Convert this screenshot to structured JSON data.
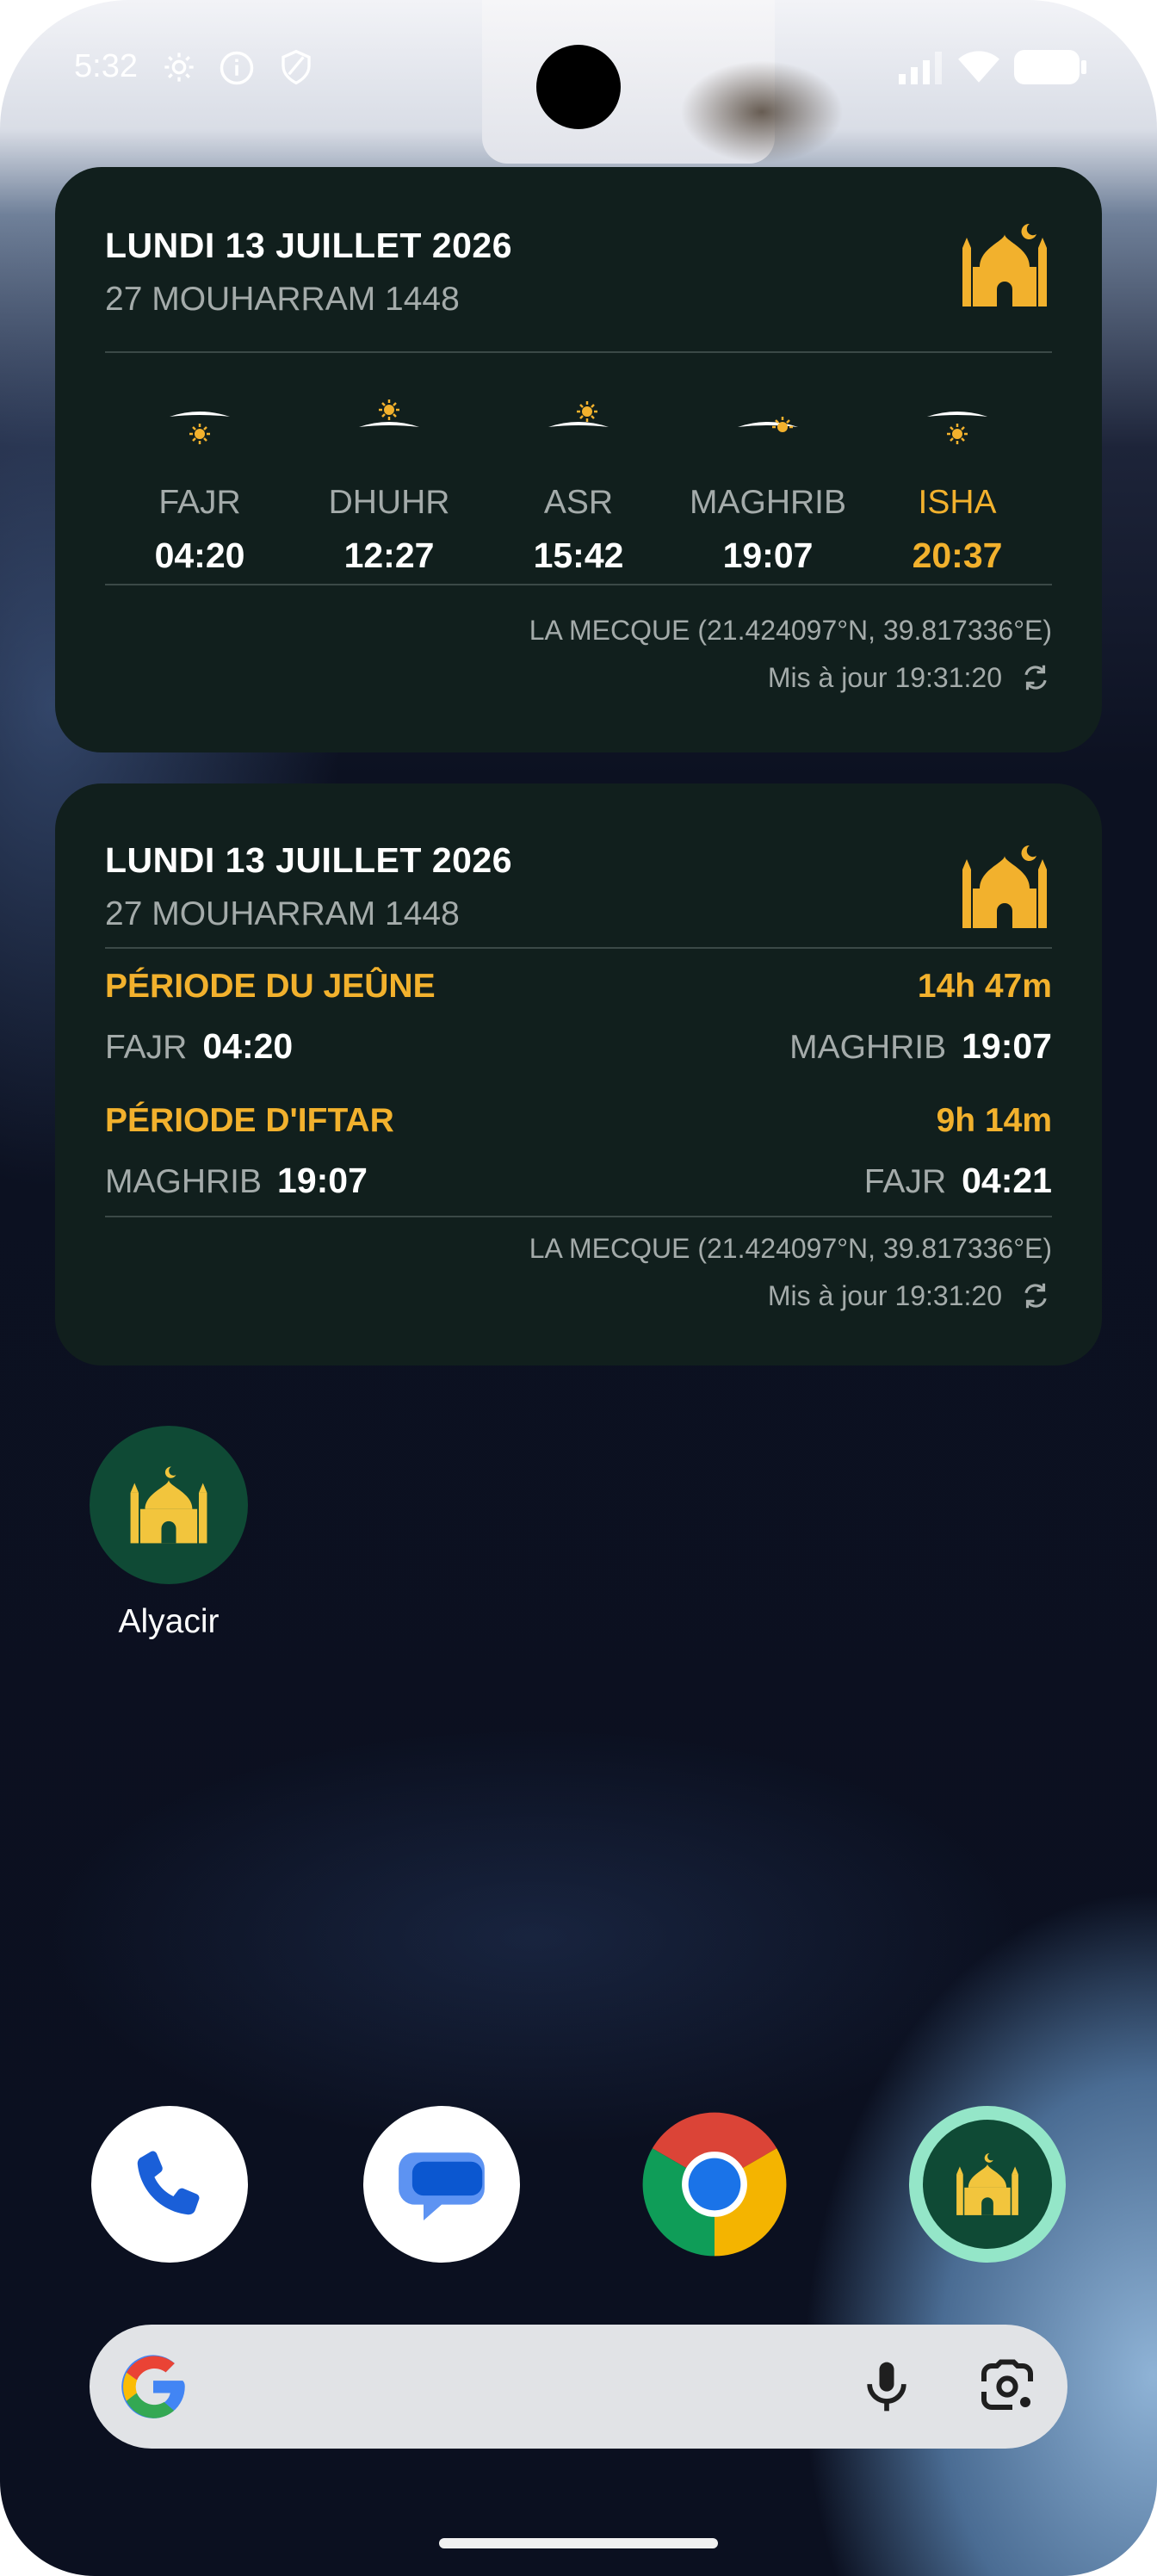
{
  "status_bar": {
    "time": "5:32",
    "icons_left": [
      "gear-icon",
      "info-icon",
      "shield-icon"
    ],
    "icons_right": [
      "signal-icon",
      "wifi-icon",
      "battery-icon"
    ]
  },
  "colors": {
    "widget_bg": "#111f1d",
    "accent": "#f2b12d",
    "muted": "#a4abaa",
    "app_icon_bg": "#0f4a35",
    "app_icon_ring": "#94e6c8"
  },
  "prayer_widget": {
    "date": "LUNDI 13 JUILLET 2026",
    "hijri": "27 MOUHARRAM 1448",
    "prayers": [
      {
        "name": "FAJR",
        "time": "04:20",
        "active": false
      },
      {
        "name": "DHUHR",
        "time": "12:27",
        "active": false
      },
      {
        "name": "ASR",
        "time": "15:42",
        "active": false
      },
      {
        "name": "MAGHRIB",
        "time": "19:07",
        "active": false
      },
      {
        "name": "ISHA",
        "time": "20:37",
        "active": true
      }
    ],
    "location": "LA MECQUE (21.424097°N, 39.817336°E)",
    "updated": "Mis à jour 19:31:20"
  },
  "fasting_widget": {
    "date": "LUNDI 13 JUILLET 2026",
    "hijri": "27 MOUHARRAM 1448",
    "fasting": {
      "label": "PÉRIODE DU JEÛNE",
      "duration": "14h 47m",
      "start_name": "FAJR",
      "start_time": "04:20",
      "end_name": "MAGHRIB",
      "end_time": "19:07"
    },
    "iftar": {
      "label": "PÉRIODE D'IFTAR",
      "duration": "9h 14m",
      "start_name": "MAGHRIB",
      "start_time": "19:07",
      "end_name": "FAJR",
      "end_time": "04:21"
    },
    "location": "LA MECQUE (21.424097°N, 39.817336°E)",
    "updated": "Mis à jour 19:31:20"
  },
  "home": {
    "app_label": "Alyacir"
  },
  "dock": [
    "phone-icon",
    "messages-icon",
    "chrome-icon",
    "alyacir-icon"
  ],
  "search": {
    "icons": [
      "google-g-icon",
      "microphone-icon",
      "google-lens-icon"
    ]
  }
}
